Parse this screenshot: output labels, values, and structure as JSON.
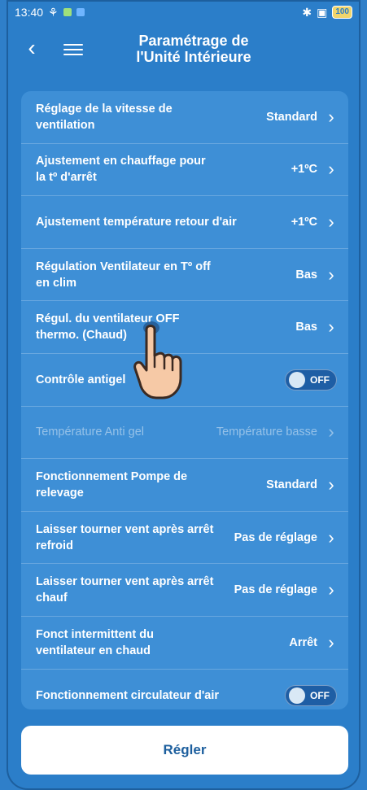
{
  "status_bar": {
    "time": "13:40",
    "battery": "100"
  },
  "header": {
    "title_line1": "Paramétrage de",
    "title_line2": "l'Unité Intérieure",
    "back": "‹"
  },
  "settings": [
    {
      "label": "Réglage de la vitesse de ventilation",
      "value": "Standard",
      "type": "nav"
    },
    {
      "label": "Ajustement en chauffage pour la tº d'arrêt",
      "value": "+1ºC",
      "type": "nav"
    },
    {
      "label": "Ajustement température retour d'air",
      "value": "+1ºC",
      "type": "nav"
    },
    {
      "label": "Régulation Ventilateur en Tº off en clim",
      "value": "Bas",
      "type": "nav"
    },
    {
      "label": "Régul. du ventilateur OFF thermo. (Chaud)",
      "value": "Bas",
      "type": "nav"
    },
    {
      "label": "Contrôle antigel",
      "value": "OFF",
      "type": "toggle"
    },
    {
      "label": "Température Anti gel",
      "value": "Température basse",
      "type": "nav-disabled"
    },
    {
      "label": "Fonctionnement Pompe de relevage",
      "value": "Standard",
      "type": "nav"
    },
    {
      "label": "Laisser tourner vent après arrêt refroid",
      "value": "Pas de réglage",
      "type": "nav"
    },
    {
      "label": "Laisser tourner vent après arrêt chauf",
      "value": "Pas de réglage",
      "type": "nav"
    },
    {
      "label": "Fonct intermittent du ventilateur en chaud",
      "value": "Arrêt",
      "type": "nav"
    },
    {
      "label": "Fonctionnement circulateur d'air",
      "value": "OFF",
      "type": "toggle"
    }
  ],
  "action_button": {
    "label": "Régler"
  },
  "colors": {
    "background": "#2b7ec9",
    "panel": "#3e8fd6",
    "button_text": "#1d5f9e"
  },
  "icons": {
    "chevron": "chevron-right-icon",
    "menu": "hamburger-menu-icon",
    "back": "back-arrow-icon",
    "hand": "pointer-hand-icon"
  }
}
